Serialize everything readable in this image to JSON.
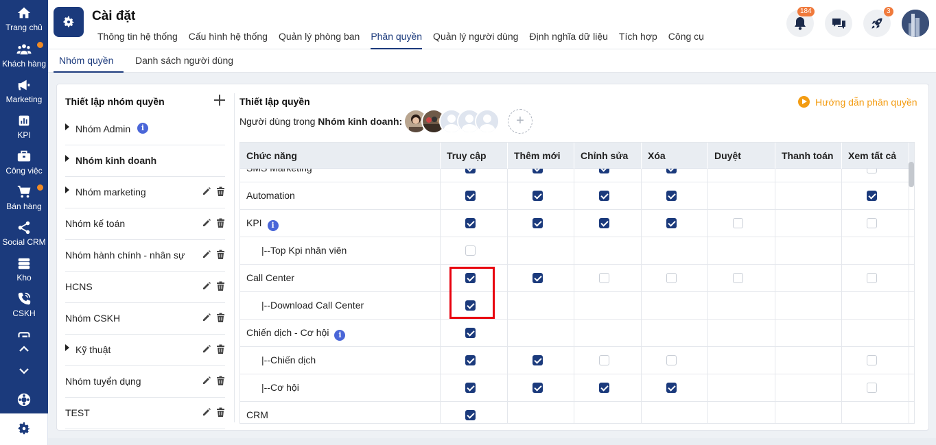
{
  "sidebar": {
    "items": [
      {
        "label": "Trang chủ",
        "icon": "home-icon",
        "dot": false
      },
      {
        "label": "Khách hàng",
        "icon": "users-icon",
        "dot": true
      },
      {
        "label": "Marketing",
        "icon": "megaphone-icon",
        "dot": false
      },
      {
        "label": "KPI",
        "icon": "chart-icon",
        "dot": false
      },
      {
        "label": "Công việc",
        "icon": "briefcase-icon",
        "dot": false
      },
      {
        "label": "Bán hàng",
        "icon": "cart-icon",
        "dot": true
      },
      {
        "label": "Social CRM",
        "icon": "share-icon",
        "dot": false
      },
      {
        "label": "Kho",
        "icon": "warehouse-icon",
        "dot": false
      },
      {
        "label": "CSKH",
        "icon": "phone-icon",
        "dot": false
      }
    ]
  },
  "header": {
    "title": "Cài đặt",
    "nav": [
      "Thông tin hệ thống",
      "Cấu hình hệ thống",
      "Quản lý phòng ban",
      "Phân quyền",
      "Quản lý người dùng",
      "Định nghĩa dữ liệu",
      "Tích hợp",
      "Công cụ"
    ],
    "active_nav": "Phân quyền",
    "notifications_count": "184",
    "rocket_count": "3"
  },
  "subtabs": {
    "groups": "Nhóm quyền",
    "users": "Danh sách người dùng"
  },
  "groups_panel": {
    "title": "Thiết lập nhóm quyền",
    "groups": [
      {
        "name": "Nhóm Admin",
        "caret": true,
        "bold": false,
        "info": true,
        "actions": false
      },
      {
        "name": "Nhóm kinh doanh",
        "caret": true,
        "bold": true,
        "info": false,
        "actions": false
      },
      {
        "name": "Nhóm marketing",
        "caret": true,
        "bold": false,
        "info": false,
        "actions": true
      },
      {
        "name": "Nhóm kế toán",
        "caret": false,
        "bold": false,
        "info": false,
        "actions": true
      },
      {
        "name": "Nhóm hành chính - nhân sự",
        "caret": false,
        "bold": false,
        "info": false,
        "actions": true
      },
      {
        "name": "HCNS",
        "caret": false,
        "bold": false,
        "info": false,
        "actions": true
      },
      {
        "name": "Nhóm CSKH",
        "caret": false,
        "bold": false,
        "info": false,
        "actions": true
      },
      {
        "name": "Kỹ thuật",
        "caret": true,
        "bold": false,
        "info": false,
        "actions": true
      },
      {
        "name": "Nhóm tuyển dụng",
        "caret": false,
        "bold": false,
        "info": false,
        "actions": true
      },
      {
        "name": "TEST",
        "caret": false,
        "bold": false,
        "info": false,
        "actions": true
      }
    ]
  },
  "permissions": {
    "title": "Thiết lập quyền",
    "guide_link": "Hướng dẫn phân quyền",
    "users_prefix": "Người dùng trong ",
    "group_name": "Nhóm kinh doanh:",
    "add_user": "+",
    "columns": [
      "Chức năng",
      "Truy cập",
      "Thêm mới",
      "Chỉnh sửa",
      "Xóa",
      "Duyệt",
      "Thanh toán",
      "Xem tất cả"
    ],
    "rows": [
      {
        "name": "SMS Marketing",
        "child": false,
        "info": false,
        "cells": [
          "on",
          "on",
          "on",
          "on",
          "",
          "",
          "off"
        ]
      },
      {
        "name": "Automation",
        "child": false,
        "info": false,
        "cells": [
          "on",
          "on",
          "on",
          "on",
          "",
          "",
          "on"
        ]
      },
      {
        "name": "KPI",
        "child": false,
        "info": true,
        "cells": [
          "on",
          "on",
          "on",
          "on",
          "off",
          "",
          "off"
        ]
      },
      {
        "name": "|--Top Kpi nhân viên",
        "child": true,
        "info": false,
        "cells": [
          "off",
          "",
          "",
          "",
          "",
          "",
          ""
        ]
      },
      {
        "name": "Call Center",
        "child": false,
        "info": false,
        "cells": [
          "on",
          "on",
          "off",
          "off",
          "off",
          "",
          "off"
        ]
      },
      {
        "name": "|--Download Call Center",
        "child": true,
        "info": false,
        "cells": [
          "on",
          "",
          "",
          "",
          "",
          "",
          ""
        ]
      },
      {
        "name": "Chiến dịch - Cơ hội",
        "child": false,
        "info": true,
        "cells": [
          "on",
          "",
          "",
          "",
          "",
          "",
          ""
        ]
      },
      {
        "name": "|--Chiến dịch",
        "child": true,
        "info": false,
        "cells": [
          "on",
          "on",
          "off",
          "off",
          "",
          "",
          "off"
        ]
      },
      {
        "name": "|--Cơ hội",
        "child": true,
        "info": false,
        "cells": [
          "on",
          "on",
          "on",
          "on",
          "",
          "",
          "off"
        ]
      },
      {
        "name": "CRM",
        "child": false,
        "info": false,
        "cells": [
          "on",
          "",
          "",
          "",
          "",
          "",
          ""
        ]
      }
    ]
  }
}
